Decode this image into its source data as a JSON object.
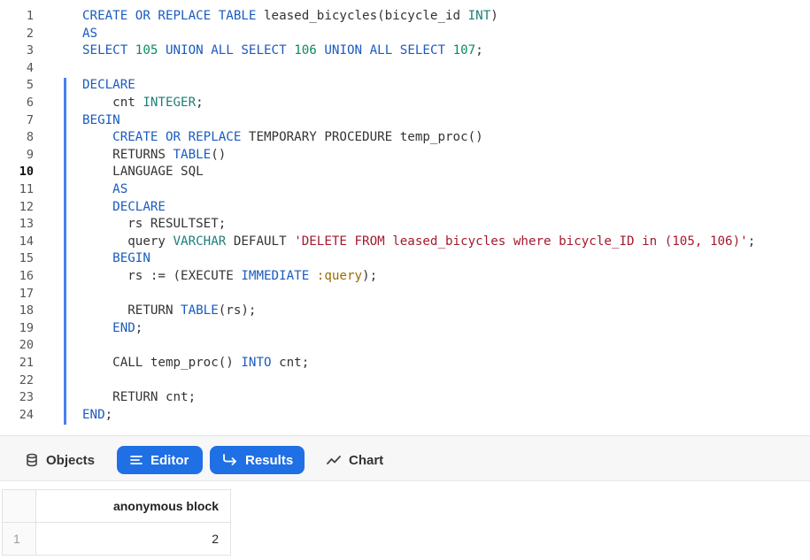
{
  "editor": {
    "active_line": 10,
    "lines": [
      {
        "n": "1",
        "tokens": [
          {
            "t": "CREATE OR REPLACE TABLE ",
            "c": "kw"
          },
          {
            "t": "leased_bicycles(bicycle_id ",
            "c": "pl"
          },
          {
            "t": "INT",
            "c": "ty"
          },
          {
            "t": ")",
            "c": "pl"
          }
        ]
      },
      {
        "n": "2",
        "tokens": [
          {
            "t": "AS",
            "c": "kw"
          }
        ]
      },
      {
        "n": "3",
        "tokens": [
          {
            "t": "SELECT ",
            "c": "kw"
          },
          {
            "t": "105 ",
            "c": "num"
          },
          {
            "t": "UNION ALL SELECT ",
            "c": "kw"
          },
          {
            "t": "106 ",
            "c": "num"
          },
          {
            "t": "UNION ALL SELECT ",
            "c": "kw"
          },
          {
            "t": "107",
            "c": "num"
          },
          {
            "t": ";",
            "c": "pl"
          }
        ]
      },
      {
        "n": "4",
        "tokens": []
      },
      {
        "n": "5",
        "tokens": [
          {
            "t": "DECLARE",
            "c": "kw"
          }
        ]
      },
      {
        "n": "6",
        "tokens": [
          {
            "t": "    cnt ",
            "c": "pl"
          },
          {
            "t": "INTEGER",
            "c": "ty"
          },
          {
            "t": ";",
            "c": "pl"
          }
        ]
      },
      {
        "n": "7",
        "tokens": [
          {
            "t": "BEGIN",
            "c": "kw"
          }
        ]
      },
      {
        "n": "8",
        "tokens": [
          {
            "t": "    ",
            "c": "pl"
          },
          {
            "t": "CREATE OR REPLACE ",
            "c": "kw"
          },
          {
            "t": "TEMPORARY PROCEDURE temp_proc()",
            "c": "pl"
          }
        ]
      },
      {
        "n": "9",
        "tokens": [
          {
            "t": "    RETURNS ",
            "c": "pl"
          },
          {
            "t": "TABLE",
            "c": "kw"
          },
          {
            "t": "()",
            "c": "pl"
          }
        ]
      },
      {
        "n": "10",
        "tokens": [
          {
            "t": "    LANGUAGE SQL",
            "c": "pl"
          }
        ]
      },
      {
        "n": "11",
        "tokens": [
          {
            "t": "    ",
            "c": "pl"
          },
          {
            "t": "AS",
            "c": "kw"
          }
        ]
      },
      {
        "n": "12",
        "tokens": [
          {
            "t": "    ",
            "c": "pl"
          },
          {
            "t": "DECLARE",
            "c": "kw"
          }
        ]
      },
      {
        "n": "13",
        "tokens": [
          {
            "t": "      rs RESULTSET;",
            "c": "pl"
          }
        ]
      },
      {
        "n": "14",
        "tokens": [
          {
            "t": "      query ",
            "c": "pl"
          },
          {
            "t": "VARCHAR ",
            "c": "ty"
          },
          {
            "t": "DEFAULT ",
            "c": "pl"
          },
          {
            "t": "'DELETE FROM leased_bicycles where bicycle_ID in (105, 106)'",
            "c": "str"
          },
          {
            "t": ";",
            "c": "pl"
          }
        ]
      },
      {
        "n": "15",
        "tokens": [
          {
            "t": "    ",
            "c": "pl"
          },
          {
            "t": "BEGIN",
            "c": "kw"
          }
        ]
      },
      {
        "n": "16",
        "tokens": [
          {
            "t": "      rs := (EXECUTE ",
            "c": "pl"
          },
          {
            "t": "IMMEDIATE ",
            "c": "kw"
          },
          {
            "t": ":query",
            "c": "var"
          },
          {
            "t": ");",
            "c": "pl"
          }
        ]
      },
      {
        "n": "17",
        "tokens": []
      },
      {
        "n": "18",
        "tokens": [
          {
            "t": "      RETURN ",
            "c": "pl"
          },
          {
            "t": "TABLE",
            "c": "kw"
          },
          {
            "t": "(rs);",
            "c": "pl"
          }
        ]
      },
      {
        "n": "19",
        "tokens": [
          {
            "t": "    ",
            "c": "pl"
          },
          {
            "t": "END",
            "c": "kw"
          },
          {
            "t": ";",
            "c": "pl"
          }
        ]
      },
      {
        "n": "20",
        "tokens": []
      },
      {
        "n": "21",
        "tokens": [
          {
            "t": "    CALL temp_proc() ",
            "c": "pl"
          },
          {
            "t": "INTO ",
            "c": "kw"
          },
          {
            "t": "cnt;",
            "c": "pl"
          }
        ]
      },
      {
        "n": "22",
        "tokens": []
      },
      {
        "n": "23",
        "tokens": [
          {
            "t": "    RETURN cnt;",
            "c": "pl"
          }
        ]
      },
      {
        "n": "24",
        "tokens": [
          {
            "t": "END",
            "c": "kw"
          },
          {
            "t": ";",
            "c": "pl"
          }
        ]
      }
    ]
  },
  "toolbar": {
    "objects_label": "Objects",
    "editor_label": "Editor",
    "results_label": "Results",
    "chart_label": "Chart",
    "icons": [
      "database-icon",
      "lines-icon",
      "arrow-return-icon",
      "trend-line-icon"
    ],
    "active_color": "#1f6fe5"
  },
  "results": {
    "column_header": "anonymous block",
    "row_number": "1",
    "value": "2"
  }
}
